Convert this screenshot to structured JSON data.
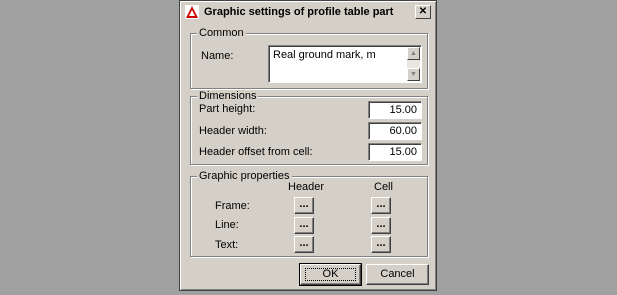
{
  "window": {
    "title": "Graphic settings of profile table part",
    "close_glyph": "✕"
  },
  "common": {
    "legend": "Common",
    "name_label": "Name:",
    "name_value": "Real ground mark, m"
  },
  "dimensions": {
    "legend": "Dimensions",
    "fields": [
      {
        "label": "Part height:",
        "value": "15.00"
      },
      {
        "label": "Header width:",
        "value": "60.00"
      },
      {
        "label": "Header offset from cell:",
        "value": "15.00"
      }
    ]
  },
  "graphic": {
    "legend": "Graphic properties",
    "col_header": "Header",
    "col_cell": "Cell",
    "rows": [
      {
        "label": "Frame:"
      },
      {
        "label": "Line:"
      },
      {
        "label": "Text:"
      }
    ],
    "button_label": "..."
  },
  "buttons": {
    "ok": "OK",
    "cancel": "Cancel"
  },
  "icons": {
    "app": "app-logo-icon",
    "scroll_up": "scroll-up-arrow-icon",
    "scroll_down": "scroll-down-arrow-icon"
  },
  "colors": {
    "desktop": "#a0a0a0",
    "dialog": "#d4d0c8"
  }
}
